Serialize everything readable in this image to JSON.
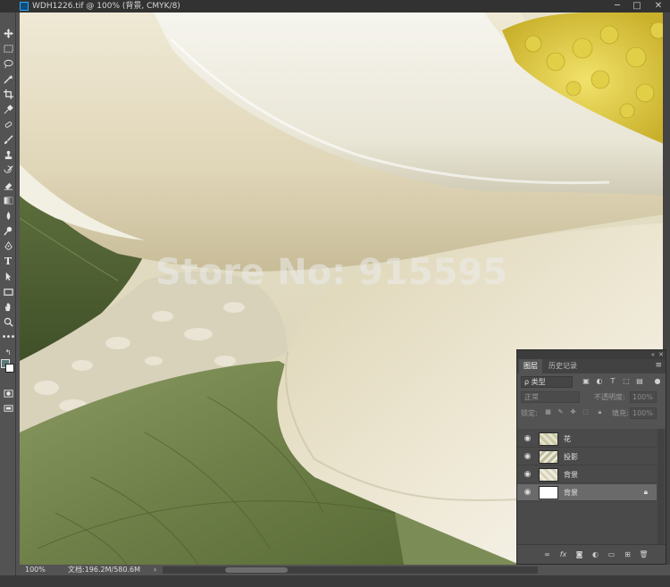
{
  "window": {
    "title": "WDH1226.tif @ 100% (背景, CMYK/8)",
    "minimize": "─",
    "maximize": "□",
    "close": "✕"
  },
  "canvas": {
    "watermark": "Store No: 915595"
  },
  "status": {
    "zoom": "100%",
    "doc_info": "文档:196.2M/580.6M",
    "arrow": "›"
  },
  "layers_panel": {
    "tabs": [
      {
        "label": "图层"
      },
      {
        "label": "历史记录"
      }
    ],
    "filter": "ρ 类型",
    "blend_mode": "正常",
    "opacity_label": "不透明度:",
    "opacity_value": "100%",
    "lock_label": "锁定:",
    "fill_label": "填充:",
    "fill_value": "100%",
    "layers": [
      {
        "name": "花",
        "visible": true,
        "selected": false,
        "locked": false
      },
      {
        "name": "投影",
        "visible": true,
        "selected": false,
        "locked": false
      },
      {
        "name": "背景",
        "visible": true,
        "selected": false,
        "locked": false
      },
      {
        "name": "背景",
        "visible": true,
        "selected": true,
        "locked": true
      }
    ]
  }
}
